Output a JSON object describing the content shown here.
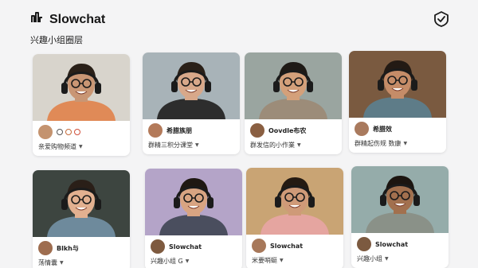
{
  "app": {
    "title": "Slowchat",
    "subtitle": "兴趣小组圈层",
    "logo_icon": "waveform-logo-icon",
    "action_icon": "shield-check-icon"
  },
  "colors": {
    "background": "#f4f4f5",
    "card": "#ffffff",
    "text": "#1a1a1a"
  },
  "cards": [
    {
      "name": "",
      "sub": "亲爱购物频道",
      "bg": "#d8d4cc",
      "shirt": "#e08a57",
      "skin": "#c99674",
      "hair": "#2a2018",
      "avatar": "#c4936f",
      "has_icons": true
    },
    {
      "name": "希腊族朋",
      "sub": "群精三积分课堂",
      "bg": "#a8b3b8",
      "shirt": "#2d2d2d",
      "skin": "#d8a88a",
      "hair": "#2a2018",
      "avatar": "#b37a5a",
      "has_icons": false
    },
    {
      "name": "Oovdle布农",
      "sub": "群发信的小作業",
      "bg": "#9aa5a0",
      "shirt": "#9c8c79",
      "skin": "#d4a07a",
      "hair": "#1e1a16",
      "avatar": "#8a5f42",
      "has_icons": false
    },
    {
      "name": "希腊效",
      "sub": "群精起伤规 数康",
      "bg": "#7a5a40",
      "shirt": "#5e7c88",
      "skin": "#c58c68",
      "hair": "#231a14",
      "avatar": "#a97a5e",
      "has_icons": false
    },
    {
      "name": "Blkh与",
      "sub": "荡情囊",
      "bg": "#3d4540",
      "shirt": "#6e8a9c",
      "skin": "#e2b090",
      "hair": "#2a1f18",
      "avatar": "#9e6d4f",
      "has_icons": false
    },
    {
      "name": "Slowchat",
      "sub": "兴趣小组 G",
      "bg": "#b4a4c8",
      "shirt": "#4a4e5e",
      "skin": "#d8a482",
      "hair": "#1f1812",
      "avatar": "#7e5a3f",
      "has_icons": false
    },
    {
      "name": "Slowchat",
      "sub": "米要哨蜓",
      "bg": "#c9a474",
      "shirt": "#e5a5a0",
      "skin": "#cf9a78",
      "hair": "#241a12",
      "avatar": "#a7785a",
      "has_icons": false
    },
    {
      "name": "Slowchat",
      "sub": "兴趣小组",
      "bg": "#95acaa",
      "shirt": "#8a9188",
      "skin": "#a2704e",
      "hair": "#1c1510",
      "avatar": "#7c5a40",
      "has_icons": false
    }
  ]
}
